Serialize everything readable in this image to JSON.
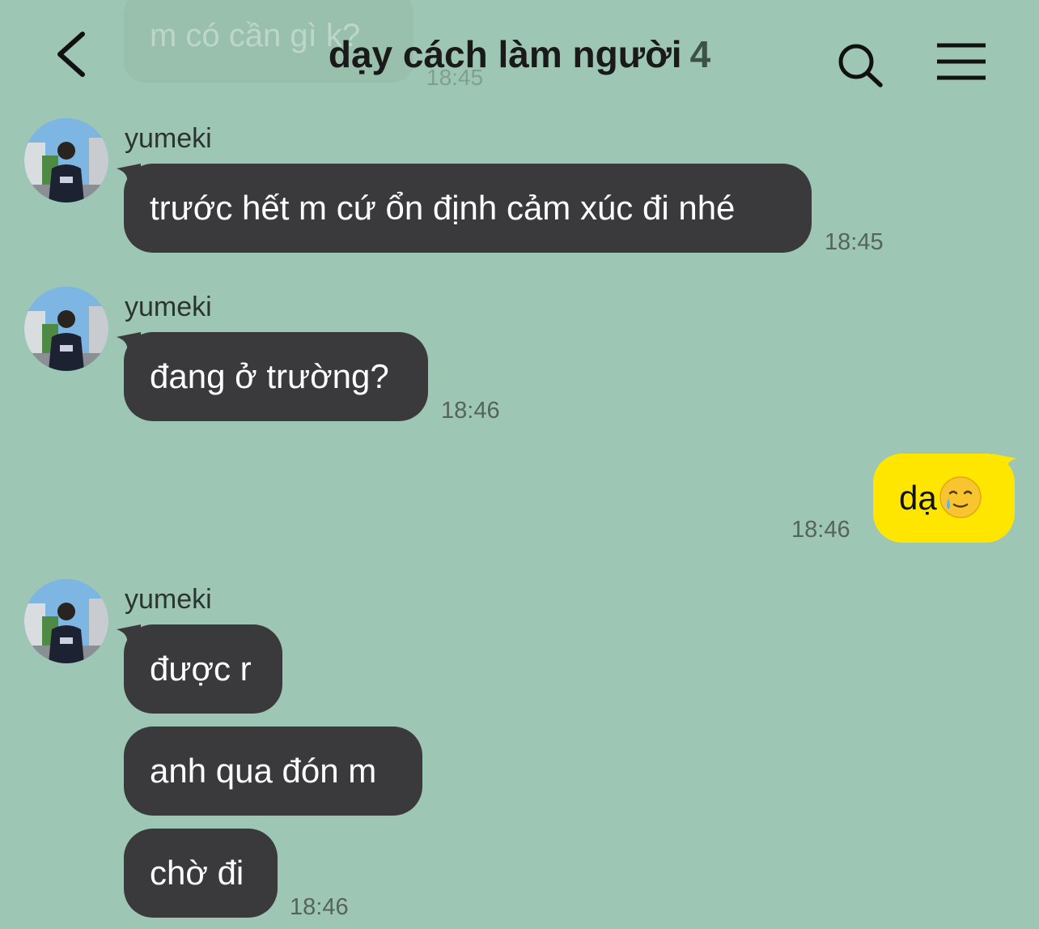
{
  "header": {
    "title": "dạy cách làm người",
    "member_count": "4"
  },
  "faded_message": {
    "text": "m có cần gì k?",
    "time": "18:45"
  },
  "messages": [
    {
      "sender": "yumeki",
      "text": "trước hết m cứ ổn định cảm xúc đi nhé",
      "time": "18:45"
    },
    {
      "sender": "yumeki",
      "text": "đang ở trường?",
      "time": "18:46"
    },
    {
      "sender": "me",
      "text": "dạ",
      "emoji": "crying-smile-emoji",
      "time": "18:46"
    },
    {
      "sender": "yumeki",
      "texts": [
        "được r",
        "anh qua đón m",
        "chờ đi"
      ],
      "time": "18:46"
    }
  ],
  "icons": {
    "back": "chevron-left-icon",
    "search": "search-icon",
    "menu": "hamburger-menu-icon"
  },
  "colors": {
    "background": "#9ec6b4",
    "incoming_bubble": "#3a3a3c",
    "outgoing_bubble": "#ffe600"
  }
}
